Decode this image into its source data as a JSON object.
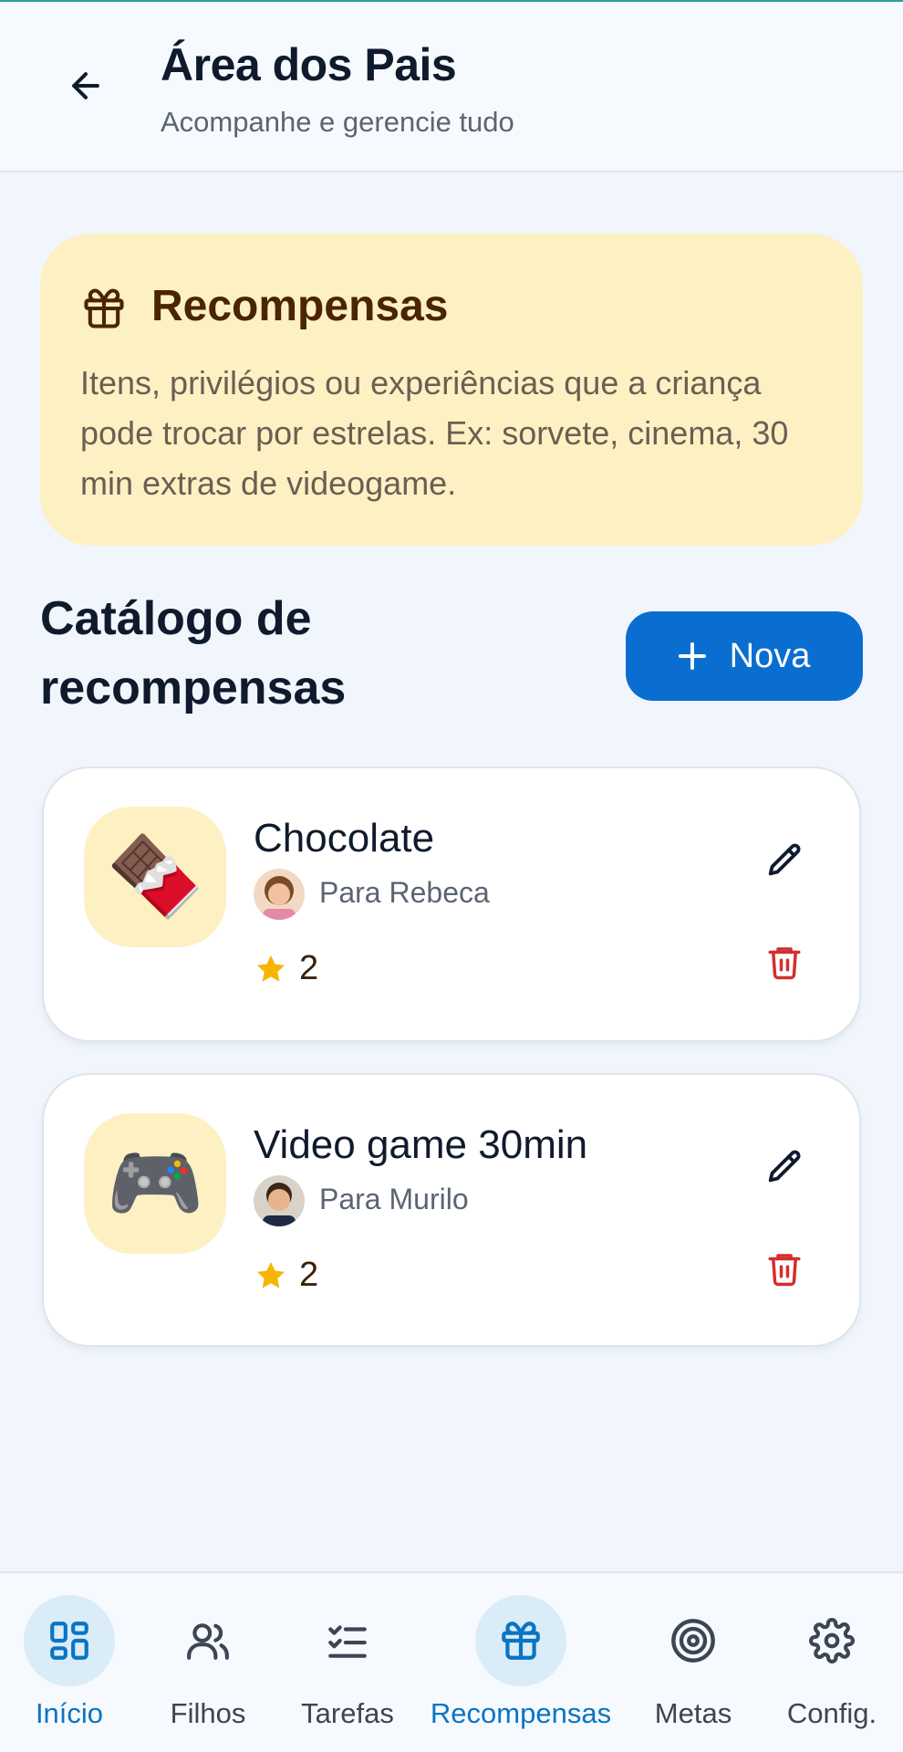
{
  "header": {
    "title": "Área dos Pais",
    "subtitle": "Acompanhe e gerencie tudo"
  },
  "info_card": {
    "icon": "gift-icon",
    "title": "Recompensas",
    "text": "Itens, privilégios ou experiências que a criança pode trocar por estrelas. Ex: sorvete, cinema, 30 min extras de videogame."
  },
  "catalog": {
    "title": "Catálogo de recompensas",
    "new_button_label": "Nova"
  },
  "rewards": [
    {
      "name": "Chocolate",
      "emoji": "🍫",
      "child": "Para Rebeca",
      "stars": "2"
    },
    {
      "name": "Video game 30min",
      "emoji": "🎮",
      "child": "Para Murilo",
      "stars": "2"
    }
  ],
  "nav": {
    "items": [
      {
        "label": "Início",
        "icon": "dashboard-icon"
      },
      {
        "label": "Filhos",
        "icon": "users-icon"
      },
      {
        "label": "Tarefas",
        "icon": "checklist-icon"
      },
      {
        "label": "Recompensas",
        "icon": "gift-icon"
      },
      {
        "label": "Metas",
        "icon": "target-icon"
      },
      {
        "label": "Config.",
        "icon": "gear-icon"
      }
    ]
  },
  "colors": {
    "primary": "#0a6ed1",
    "info_card_bg": "#fdf1c4",
    "star": "#f6b500",
    "delete": "#d32f2f",
    "nav_active": "#0a74c4"
  }
}
